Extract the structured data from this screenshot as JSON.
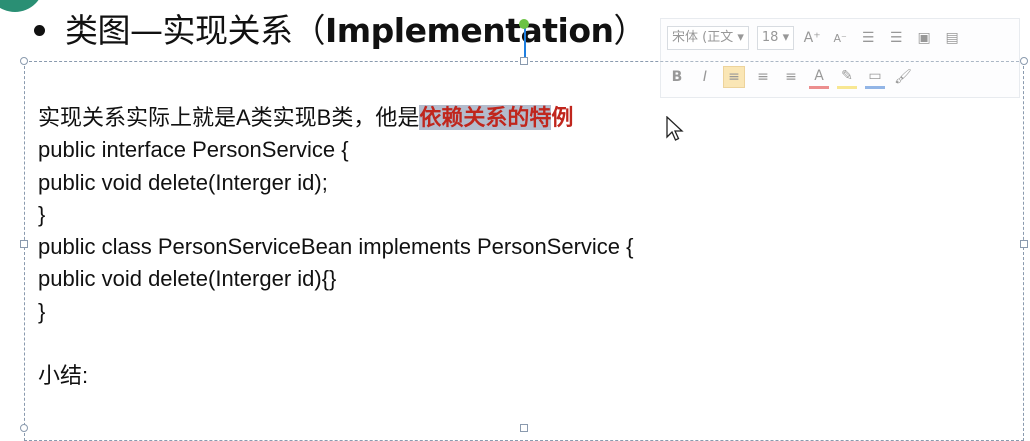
{
  "slide": {
    "title_prefix": "类图—实现关系（",
    "title_emph": "Implementation",
    "title_suffix": "）"
  },
  "textbox": {
    "line1_plain": "实现关系实际上就是A类实现B类，他是",
    "line1_highlight": "依赖关系的特",
    "line1_highlight_tail": "例",
    "code_lines": [
      "public interface PersonService {",
      "public void delete(Interger id);",
      "}",
      "public class PersonServiceBean implements PersonService {",
      "public void delete(Interger id){}",
      "}"
    ],
    "summary_label": "小结:"
  },
  "mini_toolbar": {
    "font_name": "宋体 (正文",
    "font_size": "18",
    "grow_font": "A",
    "shrink_font": "A",
    "bold": "B",
    "italic": "I",
    "font_color_letter": "A",
    "icons": [
      "increase-font-icon",
      "decrease-font-icon",
      "decrease-indent-icon",
      "increase-indent-icon",
      "bring-forward-icon",
      "send-backward-icon",
      "bold-icon",
      "italic-icon",
      "align-left-icon",
      "align-center-icon",
      "align-right-icon",
      "font-color-icon",
      "highlight-icon",
      "shape-outline-icon",
      "format-painter-icon"
    ]
  },
  "colors": {
    "highlight_text": "#c0261d",
    "selection_bg": "#b3bccd",
    "border": "#8a9aae",
    "logo": "#2a8f74"
  }
}
